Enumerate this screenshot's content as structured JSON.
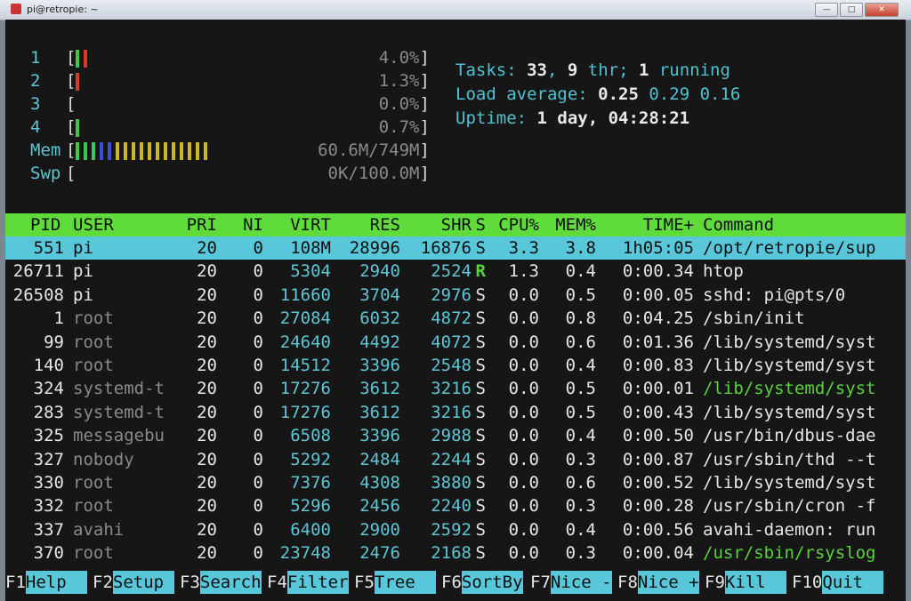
{
  "window": {
    "title": "pi@retropie: ~"
  },
  "meters": {
    "cpus": [
      {
        "label": "1",
        "bars": [
          "g",
          "r"
        ],
        "value": "4.0%"
      },
      {
        "label": "2",
        "bars": [
          "r"
        ],
        "value": "1.3%"
      },
      {
        "label": "3",
        "bars": [],
        "value": "0.0%"
      },
      {
        "label": "4",
        "bars": [
          "g"
        ],
        "value": "0.7%"
      }
    ],
    "mem": {
      "label": "Mem",
      "bars": [
        "g",
        "g",
        "g",
        "b",
        "b",
        "y",
        "y",
        "y",
        "y",
        "y",
        "y",
        "y",
        "y",
        "y",
        "y",
        "y",
        "y"
      ],
      "value": "60.6M/749M"
    },
    "swp": {
      "label": "Swp",
      "bars": [],
      "value": "0K/100.0M"
    }
  },
  "summary": {
    "tasks_label": "Tasks: ",
    "tasks": "33",
    "thr": "9",
    "thr_label": " thr; ",
    "running": "1",
    "running_label": " running",
    "load_label": "Load average: ",
    "load1": "0.25",
    "load5": "0.29",
    "load15": "0.16",
    "uptime_label": "Uptime: ",
    "uptime": "1 day, 04:28:21"
  },
  "columns": [
    "PID",
    "USER",
    "PRI",
    "NI",
    "VIRT",
    "RES",
    "SHR",
    "S",
    "CPU%",
    "MEM%",
    "TIME+",
    "Command"
  ],
  "processes": [
    {
      "pid": "551",
      "user": "pi",
      "pri": "20",
      "ni": "0",
      "virt": "108M",
      "res": "28996",
      "shr": "16876",
      "s": "S",
      "cpu": "3.3",
      "mem": "3.8",
      "time": "1h05:05",
      "cmd": "/opt/retropie/sup",
      "selected": true
    },
    {
      "pid": "26711",
      "user": "pi",
      "pri": "20",
      "ni": "0",
      "virt": "5304",
      "res": "2940",
      "shr": "2524",
      "s": "R",
      "cpu": "1.3",
      "mem": "0.4",
      "time": "0:00.34",
      "cmd": "htop"
    },
    {
      "pid": "26508",
      "user": "pi",
      "pri": "20",
      "ni": "0",
      "virt": "11660",
      "res": "3704",
      "shr": "2976",
      "s": "S",
      "cpu": "0.0",
      "mem": "0.5",
      "time": "0:00.05",
      "cmd": "sshd: pi@pts/0"
    },
    {
      "pid": "1",
      "user": "root",
      "pri": "20",
      "ni": "0",
      "virt": "27084",
      "res": "6032",
      "shr": "4872",
      "s": "S",
      "cpu": "0.0",
      "mem": "0.8",
      "time": "0:04.25",
      "cmd": "/sbin/init"
    },
    {
      "pid": "99",
      "user": "root",
      "pri": "20",
      "ni": "0",
      "virt": "24640",
      "res": "4492",
      "shr": "4072",
      "s": "S",
      "cpu": "0.0",
      "mem": "0.6",
      "time": "0:01.36",
      "cmd": "/lib/systemd/syst"
    },
    {
      "pid": "140",
      "user": "root",
      "pri": "20",
      "ni": "0",
      "virt": "14512",
      "res": "3396",
      "shr": "2548",
      "s": "S",
      "cpu": "0.0",
      "mem": "0.4",
      "time": "0:00.83",
      "cmd": "/lib/systemd/syst"
    },
    {
      "pid": "324",
      "user": "systemd-t",
      "pri": "20",
      "ni": "0",
      "virt": "17276",
      "res": "3612",
      "shr": "3216",
      "s": "S",
      "cpu": "0.0",
      "mem": "0.5",
      "time": "0:00.01",
      "cmd": "/lib/systemd/syst",
      "thread": true
    },
    {
      "pid": "283",
      "user": "systemd-t",
      "pri": "20",
      "ni": "0",
      "virt": "17276",
      "res": "3612",
      "shr": "3216",
      "s": "S",
      "cpu": "0.0",
      "mem": "0.5",
      "time": "0:00.43",
      "cmd": "/lib/systemd/syst"
    },
    {
      "pid": "325",
      "user": "messagebu",
      "pri": "20",
      "ni": "0",
      "virt": "6508",
      "res": "3396",
      "shr": "2988",
      "s": "S",
      "cpu": "0.0",
      "mem": "0.4",
      "time": "0:00.50",
      "cmd": "/usr/bin/dbus-dae"
    },
    {
      "pid": "327",
      "user": "nobody",
      "pri": "20",
      "ni": "0",
      "virt": "5292",
      "res": "2484",
      "shr": "2244",
      "s": "S",
      "cpu": "0.0",
      "mem": "0.3",
      "time": "0:00.87",
      "cmd": "/usr/sbin/thd --t"
    },
    {
      "pid": "330",
      "user": "root",
      "pri": "20",
      "ni": "0",
      "virt": "7376",
      "res": "4308",
      "shr": "3880",
      "s": "S",
      "cpu": "0.0",
      "mem": "0.6",
      "time": "0:00.52",
      "cmd": "/lib/systemd/syst"
    },
    {
      "pid": "332",
      "user": "root",
      "pri": "20",
      "ni": "0",
      "virt": "5296",
      "res": "2456",
      "shr": "2240",
      "s": "S",
      "cpu": "0.0",
      "mem": "0.3",
      "time": "0:00.28",
      "cmd": "/usr/sbin/cron -f"
    },
    {
      "pid": "337",
      "user": "avahi",
      "pri": "20",
      "ni": "0",
      "virt": "6400",
      "res": "2900",
      "shr": "2592",
      "s": "S",
      "cpu": "0.0",
      "mem": "0.4",
      "time": "0:00.56",
      "cmd": "avahi-daemon: run"
    },
    {
      "pid": "370",
      "user": "root",
      "pri": "20",
      "ni": "0",
      "virt": "23748",
      "res": "2476",
      "shr": "2168",
      "s": "S",
      "cpu": "0.0",
      "mem": "0.3",
      "time": "0:00.04",
      "cmd": "/usr/sbin/rsyslog",
      "thread": true
    }
  ],
  "fkeys": [
    {
      "key": "F1",
      "label": "Help  "
    },
    {
      "key": "F2",
      "label": "Setup "
    },
    {
      "key": "F3",
      "label": "Search"
    },
    {
      "key": "F4",
      "label": "Filter"
    },
    {
      "key": "F5",
      "label": "Tree  "
    },
    {
      "key": "F6",
      "label": "SortBy"
    },
    {
      "key": "F7",
      "label": "Nice -"
    },
    {
      "key": "F8",
      "label": "Nice +"
    },
    {
      "key": "F9",
      "label": "Kill  "
    },
    {
      "key": "F10",
      "label": "Quit  "
    }
  ],
  "colors": {
    "header_bg": "#5fdc3c",
    "selected_bg": "#57c7d9",
    "terminal_bg": "#161616",
    "label_cyan": "#5ec5d4"
  }
}
